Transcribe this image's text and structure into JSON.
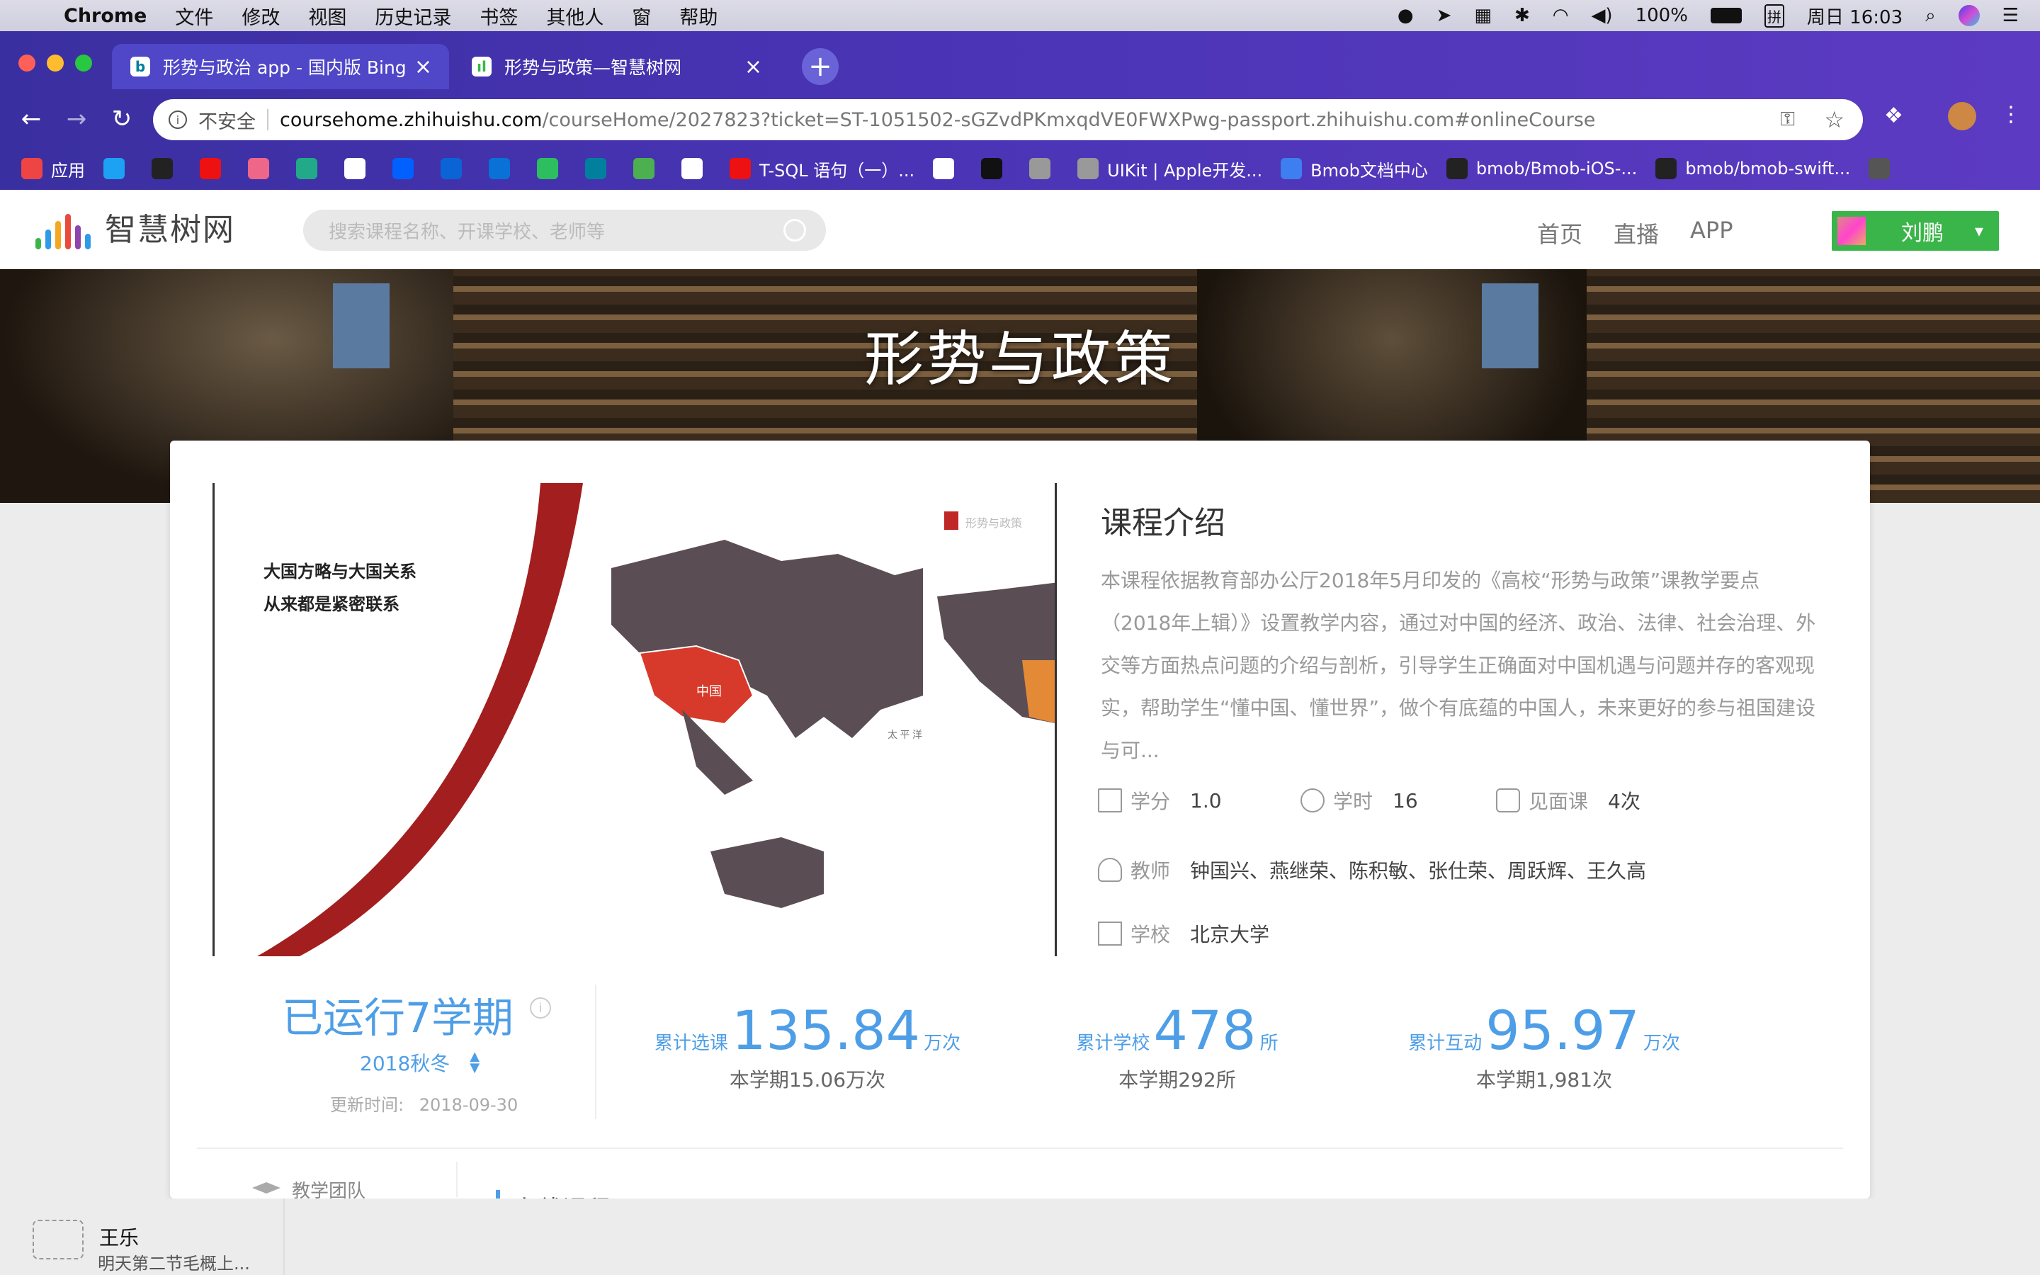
{
  "menubar": {
    "apple": "",
    "app": "Chrome",
    "items": [
      "文件",
      "修改",
      "视图",
      "历史记录",
      "书签",
      "其他人",
      "窗",
      "帮助"
    ],
    "battery": "100%",
    "clock": "周日 16:03",
    "input_method": "拼"
  },
  "browser": {
    "tabs": [
      {
        "title": "形势与政治 app - 国内版 Bing",
        "favicon": "bing-icon"
      },
      {
        "title": "形势与政策—智慧树网",
        "favicon": "zhihuishu-icon"
      }
    ],
    "close_glyph": "×",
    "newtab_glyph": "+",
    "nav": {
      "back": "←",
      "forward": "→",
      "reload": "↻"
    },
    "security_label": "不安全",
    "url_host": "coursehome.zhihuishu.com",
    "url_path": "/courseHome/2027823?ticket=ST-1051502-sGZvdPKmxqdVE0FWXPwg-passport.zhihuishu.com#onlineCourse",
    "bookmarks": [
      {
        "label": "应用",
        "icon": "apps-grid-icon",
        "color": "#e44"
      },
      {
        "label": "",
        "icon": "twitter-icon",
        "color": "#1da1f2"
      },
      {
        "label": "",
        "icon": "github-icon",
        "color": "#222"
      },
      {
        "label": "",
        "icon": "c-red-icon",
        "color": "#e11"
      },
      {
        "label": "",
        "icon": "chrome-web-icon",
        "color": "#e68"
      },
      {
        "label": "",
        "icon": "drive-icon",
        "color": "#2a8"
      },
      {
        "label": "",
        "icon": "google-icon",
        "color": "#fff"
      },
      {
        "label": "",
        "icon": "dropbox-icon",
        "color": "#0061fe"
      },
      {
        "label": "",
        "icon": "outlook-icon",
        "color": "#0a64d6"
      },
      {
        "label": "",
        "icon": "box-icon",
        "color": "#0a72d6"
      },
      {
        "label": "",
        "icon": "evernote-icon",
        "color": "#2dbe60"
      },
      {
        "label": "",
        "icon": "bing-icon",
        "color": "#00809d"
      },
      {
        "label": "",
        "icon": "green-icon",
        "color": "#4caf50"
      },
      {
        "label": "",
        "icon": "swift-icon",
        "color": "#fff"
      },
      {
        "label": "T-SQL 语句（一）...",
        "icon": "c-red-icon",
        "color": "#e11"
      },
      {
        "label": "",
        "icon": "swift-icon",
        "color": "#fff"
      },
      {
        "label": "",
        "icon": "medium-icon",
        "color": "#111"
      },
      {
        "label": "",
        "icon": "apple-icon",
        "color": "#999"
      },
      {
        "label": "UIKit | Apple开发...",
        "icon": "apple-icon",
        "color": "#999"
      },
      {
        "label": "Bmob文档中心",
        "icon": "bmob-icon",
        "color": "#3d7ef0"
      },
      {
        "label": "bmob/Bmob-iOS-...",
        "icon": "github-icon",
        "color": "#222"
      },
      {
        "label": "bmob/bmob-swift...",
        "icon": "github-icon",
        "color": "#222"
      },
      {
        "label": "",
        "icon": "paw-icon",
        "color": "#555"
      }
    ]
  },
  "site": {
    "logo_text": "智慧树网",
    "search_placeholder": "搜索课程名称、开课学校、老师等",
    "nav": [
      "首页",
      "直播",
      "APP"
    ],
    "user_name": "刘鹏",
    "caret": "▾",
    "banner_title": "形势与政策"
  },
  "course": {
    "map_caption_line1": "大国方略与大国关系",
    "map_caption_line2": "从来都是紧密联系",
    "map_china_label": "中国",
    "map_ocean_label": "太 平 洋",
    "map_watermark": "形势与政策",
    "intro_title": "课程介绍",
    "intro_text": "本课程依据教育部办公厅2018年5月印发的《高校“形势与政策”课教学要点（2018年上辑）》设置教学内容，通过对中国的经济、政治、法律、社会治理、外交等方面热点问题的介绍与剖析，引导学生正确面对中国机遇与问题并存的客观现实，帮助学生“懂中国、懂世界”，做个有底蕴的中国人，未来更好的参与祖国建设与可...",
    "credit_label": "学分",
    "credit_value": "1.0",
    "hours_label": "学时",
    "hours_value": "16",
    "meet_label": "见面课",
    "meet_value": "4次",
    "teacher_label": "教师",
    "teacher_value": "钟国兴、燕继荣、陈积敏、张仕荣、周跃辉、王久高",
    "school_label": "学校",
    "school_value": "北京大学"
  },
  "stats": {
    "run_text": "已运行7学期",
    "term": "2018秋冬",
    "updated_label": "更新时间:",
    "updated_value": "2018-09-30",
    "enroll": {
      "label": "累计选课",
      "value": "135.84",
      "unit": "万次",
      "sub": "本学期15.06万次"
    },
    "schools": {
      "label": "累计学校",
      "value": "478",
      "unit": "所",
      "sub": "本学期292所"
    },
    "interact": {
      "label": "累计互动",
      "value": "95.97",
      "unit": "万次",
      "sub": "本学期1,981次"
    }
  },
  "lower": {
    "team_label": "教学团队",
    "online_label": "在线课程"
  },
  "notification": {
    "sender": "王乐",
    "message": "明天第二节毛概上..."
  }
}
